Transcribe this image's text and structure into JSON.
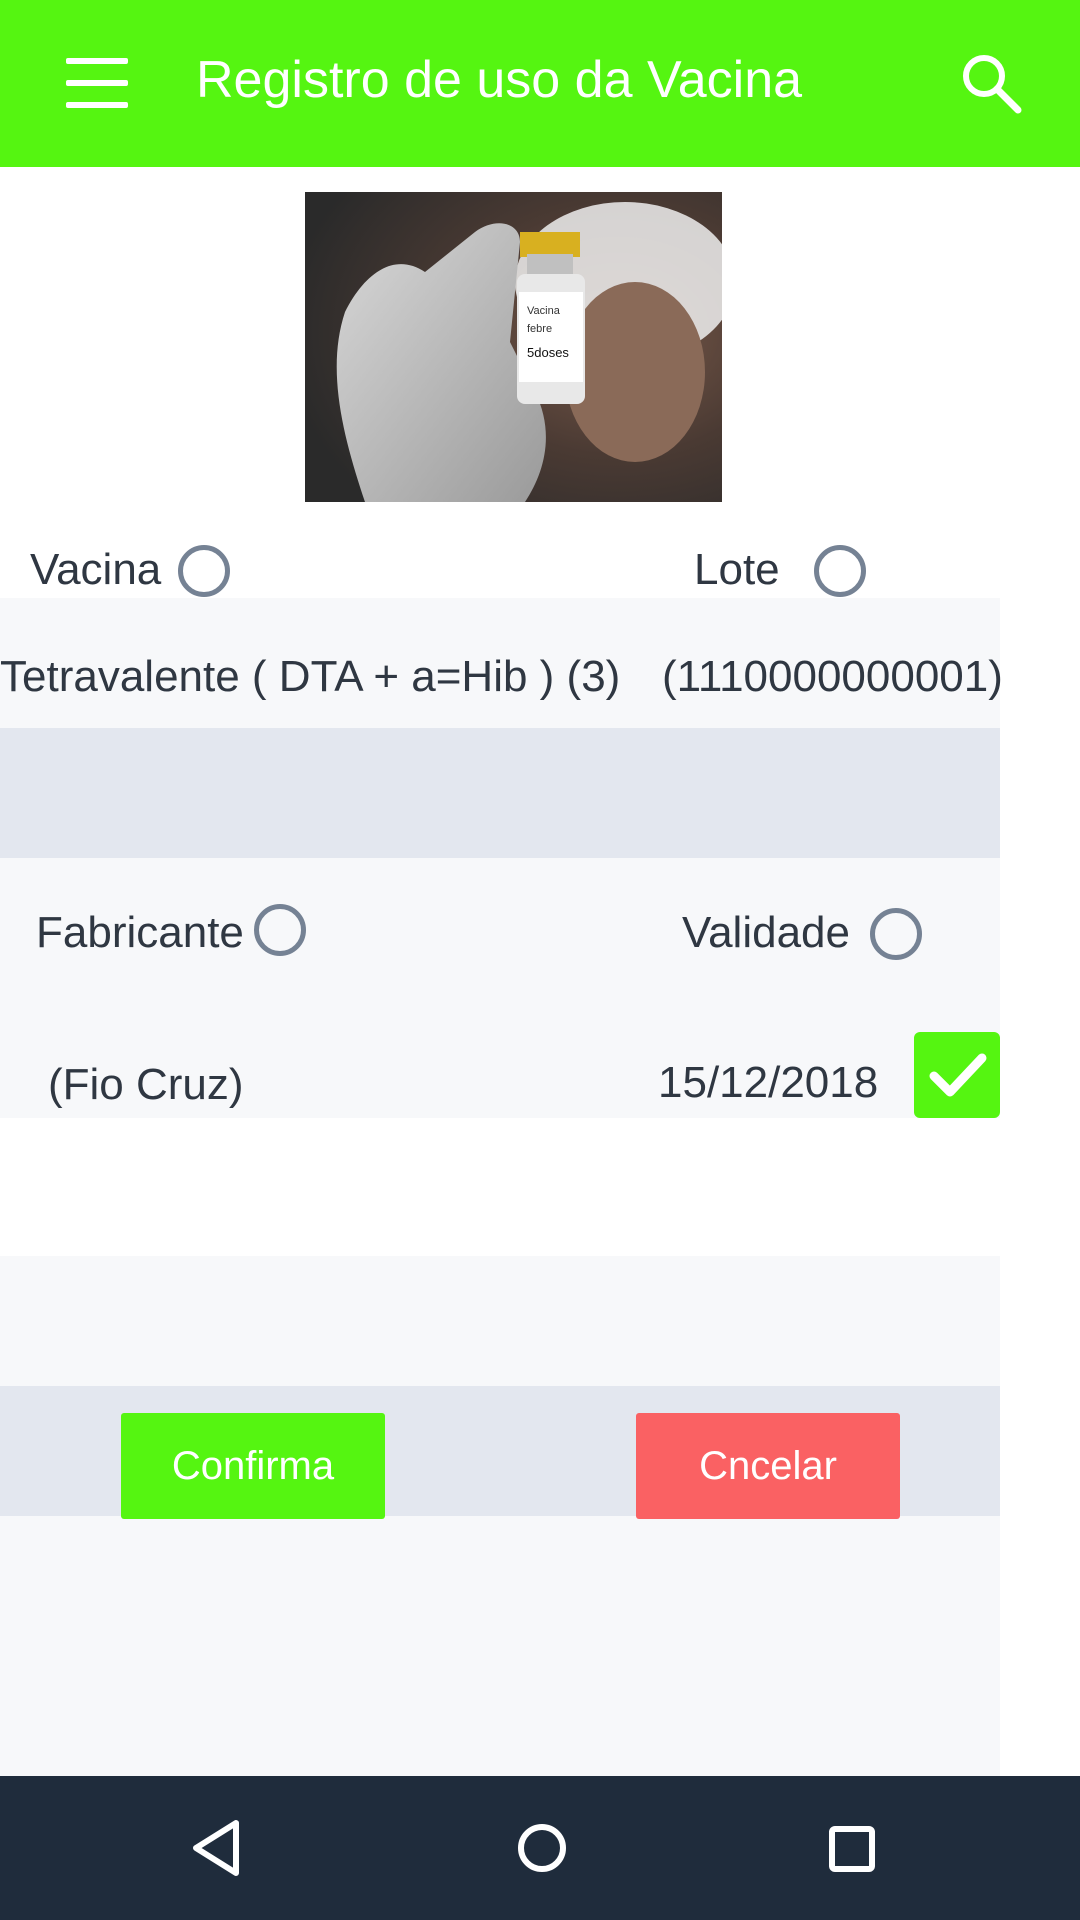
{
  "app_bar": {
    "title": "Registro de uso da Vacina",
    "background": "#55f511",
    "menu_icon": "hamburger-menu-icon",
    "search_icon": "search-icon"
  },
  "photo": {
    "description_icon": "vaccine-vial-photo"
  },
  "form": {
    "vacina_label": "Vacina",
    "lote_label": "Lote",
    "vacina_value": "Tetravalente ( DTA + a=Hib ) (3)",
    "lote_value": "(1110000000001)",
    "fabricante_label": "Fabricante",
    "validade_label": "Validade",
    "fabricante_value": "(Fio Cruz)",
    "validade_value": "15/12/2018",
    "validade_checked": true
  },
  "buttons": {
    "confirm_label": "Confirma",
    "cancel_label": "Cncelar",
    "confirm_color": "#55f511",
    "cancel_color": "#fa6163"
  },
  "nav_bar": {
    "back_icon": "back-triangle-icon",
    "home_icon": "home-circle-icon",
    "recents_icon": "recents-square-icon",
    "background": "#1f2c3c"
  }
}
